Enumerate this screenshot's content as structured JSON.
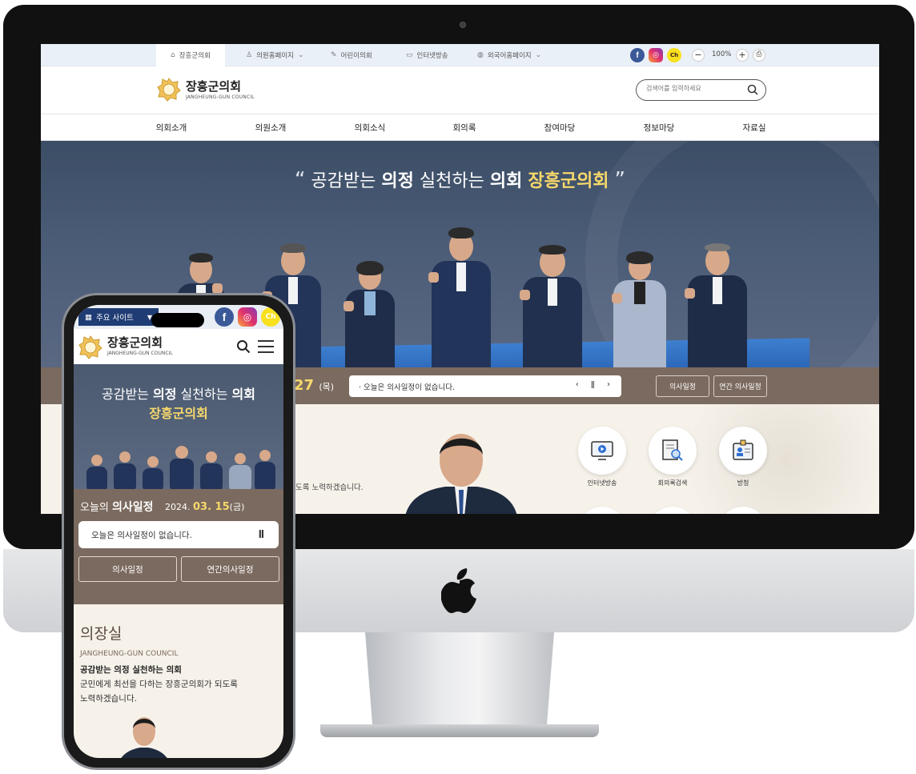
{
  "desktop": {
    "topbar": {
      "home": "장흥군의회",
      "member_home": "의원홈페이지",
      "kids": "어린이의회",
      "broadcast": "인터넷방송",
      "foreign": "외국어홈페이지",
      "zoom": "100%",
      "facebook": "f",
      "instagram": "◎",
      "kakao": "Ch"
    },
    "header": {
      "logo_title": "장흥군의회",
      "logo_sub": "JANGHEUNG-GUN COUNCIL",
      "search_placeholder": "검색어를 입력하세요"
    },
    "nav": [
      "의회소개",
      "의원소개",
      "의회소식",
      "회의록",
      "참여마당",
      "정보마당",
      "자료실"
    ],
    "hero": {
      "slogan_part1": "공감받는",
      "slogan_bold1": "의정",
      "slogan_part2": "실천하는",
      "slogan_bold2": "의회",
      "slogan_highlight": "장흥군의회"
    },
    "ticker": {
      "date_num": "27",
      "date_day": "(목)",
      "message": "· 오늘은 의사일정이 없습니다.",
      "controls": "‹ ǁ ›",
      "btn_schedule": "의사일정",
      "btn_annual": "연간 의사일정"
    },
    "content": {
      "desc": "도록 노력하겠습니다.",
      "quick_links": [
        "인터넷방송",
        "회의록검색",
        "방청"
      ]
    }
  },
  "mobile": {
    "topbar": {
      "sites": "주요 사이트",
      "facebook": "f",
      "instagram": "◎",
      "kakao": "Ch"
    },
    "header": {
      "logo_title": "장흥군의회",
      "logo_sub": "JANGHEUNG-GUN COUNCIL"
    },
    "hero": {
      "line1_part1": "공감받는",
      "line1_bold1": "의정",
      "line1_part2": "실천하는",
      "line1_bold2": "의회",
      "line2": "장흥군의회"
    },
    "schedule": {
      "title_pre": "오늘의",
      "title_bold": "의사일정",
      "date_year": "2024.",
      "date_md": "03. 15",
      "date_day": "(금)",
      "message": "오늘은 의사일정이 없습니다.",
      "pause": "ǁ",
      "btn_schedule": "의사일정",
      "btn_annual": "연간의사일정"
    },
    "chairman": {
      "title": "의장실",
      "en": "JANGHEUNG-GUN COUNCIL",
      "slogan": "공감받는 의정 실천하는 의회",
      "desc_line1": "군민에게 최선을 다하는 장흥군의회가 되도록",
      "desc_line2": "노력하겠습니다."
    }
  },
  "colors": {
    "brown": "#7b6a5f",
    "gold": "#f6d86b",
    "navy": "#1f3c74",
    "cream": "#f6f2ea"
  }
}
